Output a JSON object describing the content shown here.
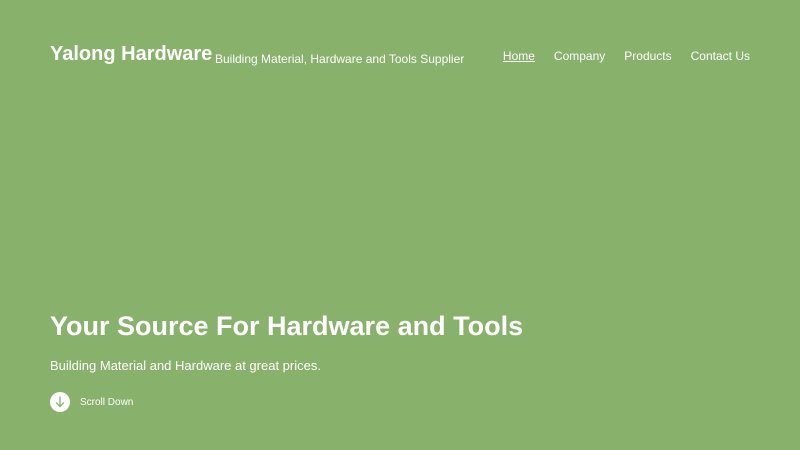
{
  "header": {
    "site_title": "Yalong Hardware",
    "tagline": "Building Material, Hardware and Tools Supplier"
  },
  "nav": {
    "items": [
      {
        "label": "Home",
        "active": true
      },
      {
        "label": "Company",
        "active": false
      },
      {
        "label": "Products",
        "active": false
      },
      {
        "label": "Contact Us",
        "active": false
      }
    ]
  },
  "hero": {
    "title": "Your Source For Hardware and Tools",
    "subtitle": "Building Material and Hardware at great prices.",
    "scroll_label": "Scroll Down",
    "scroll_icon": "arrow-down-icon"
  },
  "colors": {
    "background": "#88b26c",
    "text": "#ffffff",
    "icon": "#88b26c"
  }
}
